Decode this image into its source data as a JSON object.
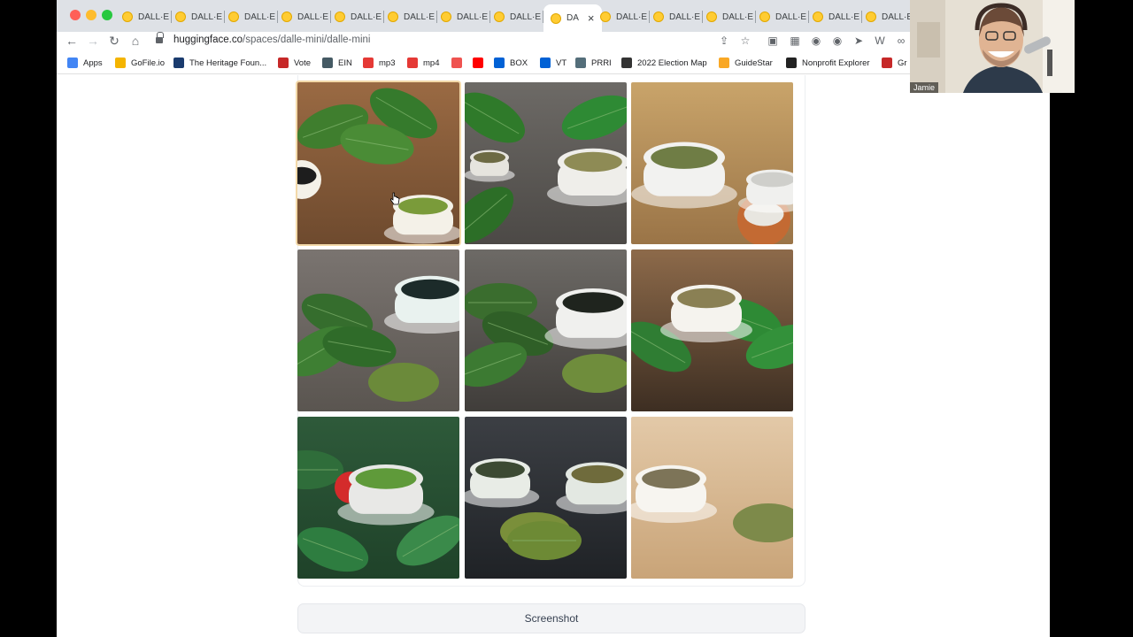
{
  "browser": {
    "tabs": [
      {
        "label": "DALL·E"
      },
      {
        "label": "DALL·E"
      },
      {
        "label": "DALL·E"
      },
      {
        "label": "DALL·E"
      },
      {
        "label": "DALL·E"
      },
      {
        "label": "DALL·E"
      },
      {
        "label": "DALL·E"
      },
      {
        "label": "DALL·E"
      },
      {
        "label": "DA",
        "active": true
      },
      {
        "label": "DALL·E"
      },
      {
        "label": "DALL·E"
      },
      {
        "label": "DALL·E"
      },
      {
        "label": "DALL·E"
      },
      {
        "label": "DALL·E"
      },
      {
        "label": "DALL·E"
      }
    ],
    "url_domain": "huggingface.co",
    "url_path": "/spaces/dalle-mini/dalle-mini",
    "bookmarks": [
      {
        "label": "Apps",
        "icon": "apps-grid-icon",
        "color": "#4285f4"
      },
      {
        "label": "GoFile.io",
        "icon": "gofile-icon",
        "color": "#f4b400"
      },
      {
        "label": "The Heritage Foun...",
        "icon": "heritage-icon",
        "color": "#1a3b6e"
      },
      {
        "label": "Vote",
        "icon": "vote-icon",
        "color": "#c62828"
      },
      {
        "label": "EIN",
        "icon": "globe-icon",
        "color": "#455a64"
      },
      {
        "label": "mp3",
        "icon": "mp3-icon",
        "color": "#e53935"
      },
      {
        "label": "mp4",
        "icon": "mp4-icon",
        "color": "#e53935"
      },
      {
        "label": "",
        "icon": "bookmark-icon",
        "color": "#ef5350"
      },
      {
        "label": "",
        "icon": "youtube-icon",
        "color": "#ff0000"
      },
      {
        "label": "BOX",
        "icon": "box-icon",
        "color": "#0061d5"
      },
      {
        "label": "VT",
        "icon": "vt-icon",
        "color": "#0061d5"
      },
      {
        "label": "PRRI",
        "icon": "prri-icon",
        "color": "#546e7a"
      },
      {
        "label": "2022 Election Map",
        "icon": "election-map-icon",
        "color": "#333333"
      },
      {
        "label": "GuideStar",
        "icon": "guidestar-icon",
        "color": "#f9a825"
      },
      {
        "label": "Nonprofit Explorer",
        "icon": "propublica-icon",
        "color": "#222222"
      },
      {
        "label": "Gr",
        "icon": "gr-icon",
        "color": "#c62828"
      }
    ]
  },
  "gallery": {
    "images": [
      {
        "name": "matcha-image-1",
        "theme": "leaves-wood-bowl"
      },
      {
        "name": "matcha-image-2",
        "theme": "cups-leaves-gray"
      },
      {
        "name": "matcha-image-3",
        "theme": "white-cups-tan"
      },
      {
        "name": "matcha-image-4",
        "theme": "cup-leaves-powder"
      },
      {
        "name": "matcha-image-5",
        "theme": "cup-leaves-powder-dark"
      },
      {
        "name": "matcha-image-6",
        "theme": "cup-leaves-brown"
      },
      {
        "name": "matcha-image-7",
        "theme": "green-cup-red-handle"
      },
      {
        "name": "matcha-image-8",
        "theme": "cups-spoon-dark"
      },
      {
        "name": "matcha-image-9",
        "theme": "cup-powder-tan"
      }
    ],
    "selected_index": 0
  },
  "screenshot_button": {
    "label": "Screenshot"
  },
  "webcam": {
    "name": "Jamie"
  }
}
